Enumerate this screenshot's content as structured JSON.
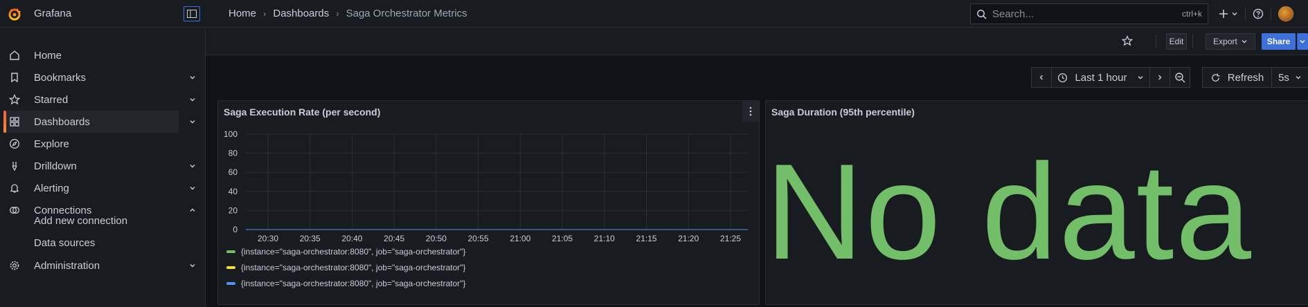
{
  "app": {
    "name": "Grafana"
  },
  "breadcrumb": [
    "Home",
    "Dashboards",
    "Saga Orchestrator Metrics"
  ],
  "search": {
    "placeholder": "Search...",
    "shortcut": "ctrl+k"
  },
  "sidebar": {
    "items": [
      {
        "label": "Home",
        "icon": "home-icon",
        "chevron": false
      },
      {
        "label": "Bookmarks",
        "icon": "bookmark-icon",
        "chevron": "down"
      },
      {
        "label": "Starred",
        "icon": "star-icon",
        "chevron": "down"
      },
      {
        "label": "Dashboards",
        "icon": "apps-icon",
        "chevron": "down",
        "active": true
      },
      {
        "label": "Explore",
        "icon": "compass-icon",
        "chevron": false
      },
      {
        "label": "Drilldown",
        "icon": "drilldown-icon",
        "chevron": "down"
      },
      {
        "label": "Alerting",
        "icon": "bell-icon",
        "chevron": "down"
      },
      {
        "label": "Connections",
        "icon": "connections-icon",
        "chevron": "up"
      }
    ],
    "sub_items": [
      "Add new connection",
      "Data sources"
    ],
    "admin": {
      "label": "Administration",
      "icon": "gear-icon"
    }
  },
  "toolbar": {
    "edit": "Edit",
    "export": "Export",
    "share": "Share"
  },
  "time": {
    "range": "Last 1 hour",
    "refresh": "Refresh",
    "interval": "5s"
  },
  "panels": {
    "rate": {
      "title": "Saga Execution Rate (per second)",
      "legend": [
        {
          "label": "{instance=\"saga-orchestrator:8080\", job=\"saga-orchestrator\"}",
          "color": "#73bf69"
        },
        {
          "label": "{instance=\"saga-orchestrator:8080\", job=\"saga-orchestrator\"}",
          "color": "#fade2a"
        },
        {
          "label": "{instance=\"saga-orchestrator:8080\", job=\"saga-orchestrator\"}",
          "color": "#5794f2"
        }
      ]
    },
    "duration": {
      "title": "Saga Duration (95th percentile)",
      "message": "No data"
    }
  },
  "chart_data": {
    "type": "line",
    "x": [
      "20:30",
      "20:35",
      "20:40",
      "20:45",
      "20:50",
      "20:55",
      "21:00",
      "21:05",
      "21:10",
      "21:15",
      "21:20",
      "21:25"
    ],
    "yticks": [
      0,
      20,
      40,
      60,
      80,
      100
    ],
    "ylim": [
      0,
      100
    ],
    "grid": true,
    "legend_placement": "bottom",
    "series": [
      {
        "name": "{instance=\"saga-orchestrator:8080\", job=\"saga-orchestrator\"}",
        "color": "#73bf69",
        "values": [
          0,
          0,
          0,
          0,
          0,
          0,
          0,
          0,
          0,
          0,
          0,
          0
        ]
      },
      {
        "name": "{instance=\"saga-orchestrator:8080\", job=\"saga-orchestrator\"}",
        "color": "#fade2a",
        "values": [
          0,
          0,
          0,
          0,
          0,
          0,
          0,
          0,
          0,
          0,
          0,
          0
        ]
      },
      {
        "name": "{instance=\"saga-orchestrator:8080\", job=\"saga-orchestrator\"}",
        "color": "#5794f2",
        "values": [
          0,
          0,
          0,
          0,
          0,
          0,
          0,
          0,
          0,
          0,
          0,
          0
        ]
      }
    ]
  }
}
